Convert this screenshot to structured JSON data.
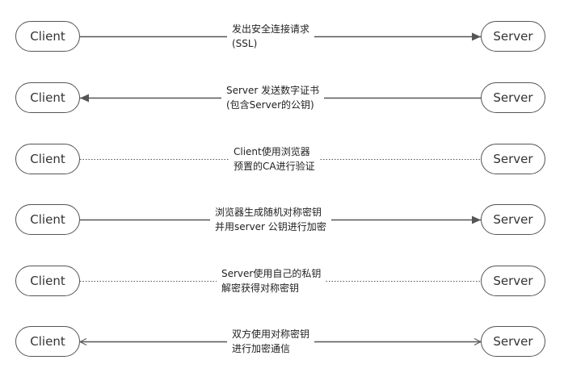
{
  "colors": {
    "line": "#555555",
    "text": "#333333",
    "node_border": "#555555"
  },
  "steps": [
    {
      "client": "Client",
      "server": "Server",
      "line1": "发出安全连接请求",
      "line2": "(SSL)",
      "line_style": "solid",
      "direction": "to-server"
    },
    {
      "client": "Client",
      "server": "Server",
      "line1": "Server 发送数字证书",
      "line2": "(包含Server的公钥)",
      "line_style": "solid",
      "direction": "to-client"
    },
    {
      "client": "Client",
      "server": "Server",
      "line1": "Client使用浏览器",
      "line2": "预置的CA进行验证",
      "line_style": "dotted",
      "direction": "none"
    },
    {
      "client": "Client",
      "server": "Server",
      "line1": "浏览器生成随机对称密钥",
      "line2": "并用server 公钥进行加密",
      "line_style": "solid",
      "direction": "to-server"
    },
    {
      "client": "Client",
      "server": "Server",
      "line1": "Server使用自己的私钥",
      "line2": "解密获得对称密钥",
      "line_style": "dotted",
      "direction": "none"
    },
    {
      "client": "Client",
      "server": "Server",
      "line1": "双方使用对称密钥",
      "line2": "进行加密通信",
      "line_style": "solid",
      "direction": "both"
    }
  ]
}
